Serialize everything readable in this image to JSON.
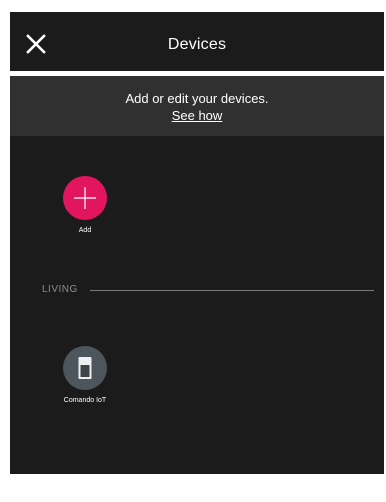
{
  "header": {
    "title": "Devices",
    "close_icon": "close-icon"
  },
  "banner": {
    "text": "Add or edit your devices.",
    "link": "See how"
  },
  "add_tile": {
    "label": "Add",
    "icon": "plus-icon",
    "color": "#e2165e"
  },
  "sections": [
    {
      "name": "LIVING",
      "devices": [
        {
          "label": "Comando IoT",
          "icon": "switch-icon",
          "color": "#4d565c"
        }
      ]
    }
  ],
  "colors": {
    "background": "#1b1b1b",
    "banner": "#303030",
    "accent": "#e2165e"
  }
}
